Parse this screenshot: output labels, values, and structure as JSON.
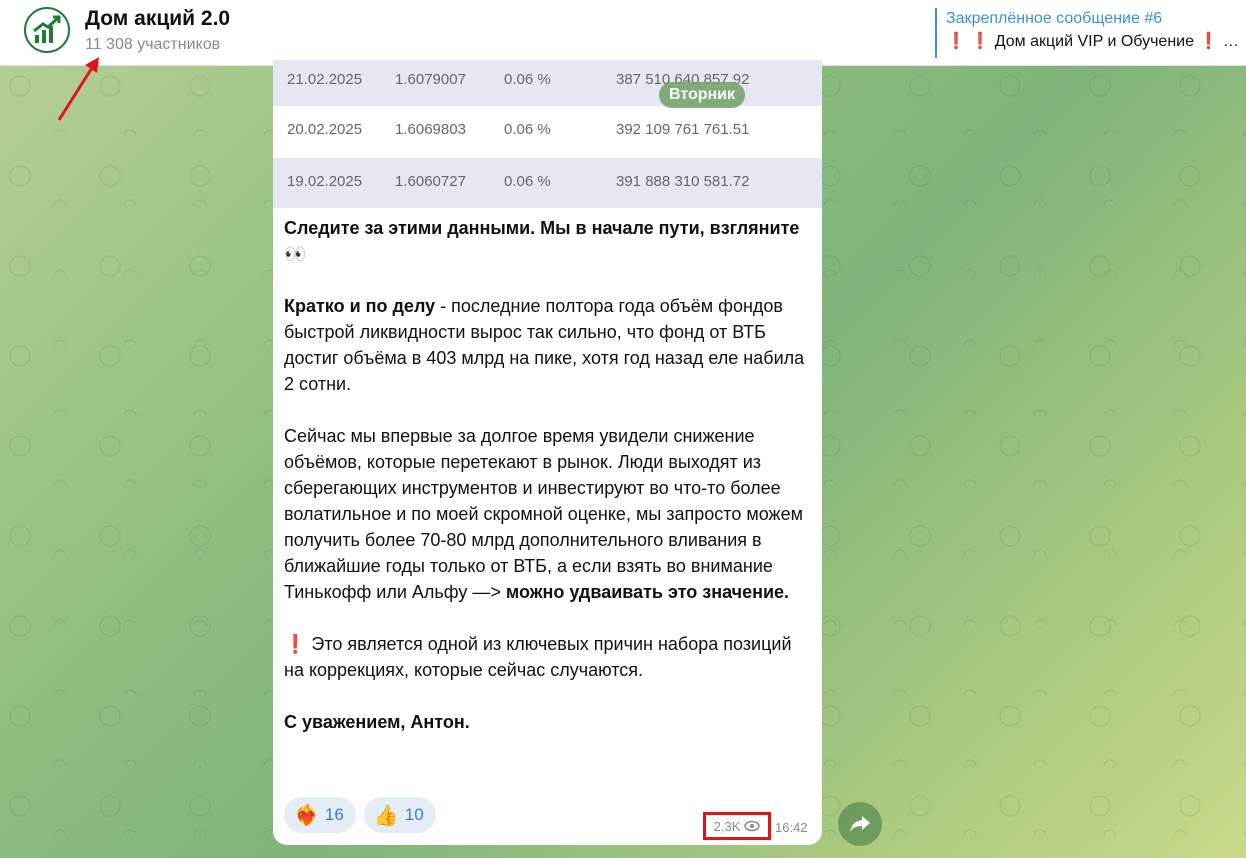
{
  "header": {
    "channel_title": "Дом акций 2.0",
    "channel_subtitle": "11 308 участников",
    "pinned_title": "Закреплённое сообщение #6",
    "pinned_text": "Дом акций VIP и Обучение",
    "pinned_ellipsis": "…"
  },
  "table": {
    "rows": [
      {
        "date": "21.02.2025",
        "value": "1.6079007",
        "pct": "0.06 %",
        "amount": "387 510 640 857.92"
      },
      {
        "date": "20.02.2025",
        "value": "1.6069803",
        "pct": "0.06 %",
        "amount": "392 109 761 761.51"
      },
      {
        "date": "19.02.2025",
        "value": "1.6060727",
        "pct": "0.06 %",
        "amount": "391 888 310 581.72"
      }
    ]
  },
  "date_pill": "Вторник",
  "message": {
    "p1_bold": "Следите за этими данными. Мы в начале пути, взгляните",
    "p1_emoji": "👀",
    "p2_bold": "Кратко и по делу",
    "p2_text": " - последние полтора года объём фондов быстрой ликвидности вырос так сильно, что фонд от ВТБ достиг объёма в 403 млрд на пике, хотя год назад еле набила 2 сотни.",
    "p3_text": "Сейчас мы впервые за долгое время увидели снижение объёмов, которые перетекают в рынок. Люди выходят из сберегающих инструментов и инвестируют во что-то более волатильное и по моей скромной оценке, мы запросто можем получить более 70-80 млрд дополнительного вливания в ближайшие годы только от ВТБ, а если взять во внимание Тинькофф или Альфу —>",
    "p3_bold": " можно удваивать это значение.",
    "p4_icon": "❗",
    "p4_text": " Это является одной из ключевых причин набора позиций на коррекциях, которые сейчас случаются.",
    "p5_bold": "С уважением, Антон."
  },
  "reactions": [
    {
      "emoji": "❤️‍🔥",
      "count": "16"
    },
    {
      "emoji": "👍",
      "count": "10"
    }
  ],
  "meta": {
    "views": "2,3K",
    "time": "16:42"
  },
  "colors": {
    "accent": "#3a8fdc",
    "highlight_box": "#e0141c",
    "table_stripe": "#e7e7f3"
  }
}
